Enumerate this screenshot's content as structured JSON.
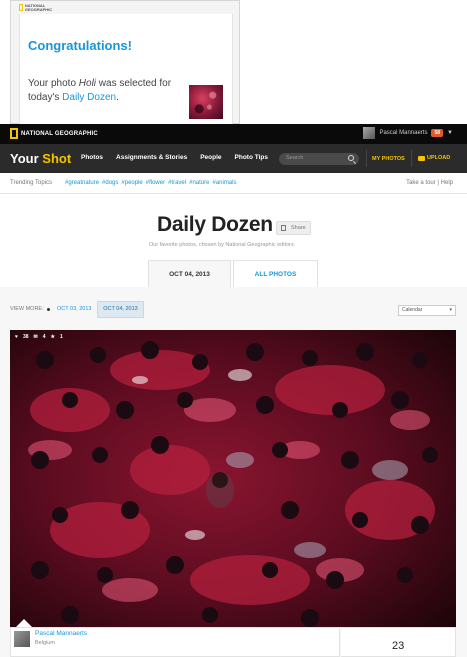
{
  "email": {
    "brand": "NATIONAL GEOGRAPHIC",
    "heading": "Congratulations!",
    "line1_prefix": "Your photo ",
    "photo_title": "Holi",
    "line1_suffix": " was selected for",
    "line2_prefix": "today's ",
    "link": "Daily Dozen",
    "line2_suffix": "."
  },
  "topbar": {
    "brand": "NATIONAL GEOGRAPHIC",
    "user_name": "Pascal Mannaerts",
    "badge": "58"
  },
  "nav": {
    "logo_your": "Your",
    "logo_shot": "Shot",
    "items": [
      "Photos",
      "Assignments & Stories",
      "People",
      "Photo Tips"
    ],
    "search_placeholder": "Search",
    "my_photos": "MY PHOTOS",
    "upload": "UPLOAD"
  },
  "trending": {
    "label": "Trending Topics",
    "tags": [
      "#greatnature",
      "#dogs",
      "#people",
      "#flower",
      "#travel",
      "#nature",
      "#animals"
    ],
    "right": "Take a tour  |  Help"
  },
  "page": {
    "title": "Daily Dozen",
    "share": "Share",
    "subtitle": "Our favorite photos, chosen by National Geographic editors.",
    "tab_active": "OCT 04, 2013",
    "tab_inactive": "ALL PHOTOS",
    "view_more": "VIEW MORE:",
    "date_prev": "OCT 03, 2013",
    "date_current": "OCT 04, 2013",
    "calendar": "Calendar"
  },
  "photo": {
    "likes": "38",
    "comments": "4",
    "favs": "1"
  },
  "credit": {
    "name": "Pascal Mannaerts",
    "location": "Belgium",
    "count": "23"
  },
  "colors": {
    "accent_blue": "#1996d8",
    "brand_yellow": "#f5c400",
    "nav_dark": "#2b2b2b"
  }
}
